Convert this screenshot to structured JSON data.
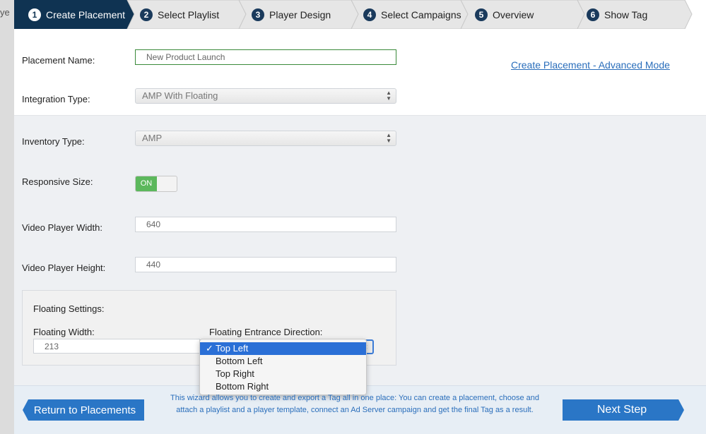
{
  "background_edge_text": "ye",
  "steps": [
    {
      "num": "1",
      "label": "Create Placement",
      "active": true
    },
    {
      "num": "2",
      "label": "Select Playlist"
    },
    {
      "num": "3",
      "label": "Player Design"
    },
    {
      "num": "4",
      "label": "Select Campaigns"
    },
    {
      "num": "5",
      "label": "Overview"
    },
    {
      "num": "6",
      "label": "Show Tag"
    }
  ],
  "form": {
    "placement_name_label": "Placement Name:",
    "placement_name_value": "New Product Launch",
    "integration_type_label": "Integration Type:",
    "integration_type_value": "AMP With Floating",
    "inventory_type_label": "Inventory Type:",
    "inventory_type_value": "AMP",
    "responsive_size_label": "Responsive Size:",
    "responsive_toggle": "ON",
    "video_width_label": "Video Player Width:",
    "video_width_value": "640",
    "video_height_label": "Video Player Height:",
    "video_height_value": "440",
    "floating_settings_label": "Floating Settings:",
    "floating_width_label": "Floating Width:",
    "floating_width_value": "213",
    "floating_direction_label": "Floating Entrance Direction:"
  },
  "advanced_link": "Create Placement - Advanced Mode",
  "direction_options": [
    "Top Left",
    "Bottom Left",
    "Top Right",
    "Bottom Right"
  ],
  "direction_selected": "Top Left",
  "footer": {
    "return_button": "Return to Placements",
    "next_button": "Next Step",
    "info_text": "This wizard allows you to create and export a Tag all in one place: You can create a placement, choose and attach a playlist and a player template, connect an Ad Server campaign and get the final Tag as a result."
  },
  "colors": {
    "active_step": "#0f3352",
    "step_bg": "#e6e6e6",
    "accent_blue": "#2a76c6",
    "toggle_on": "#5cb85c",
    "selected_option": "#2a6fd6"
  }
}
